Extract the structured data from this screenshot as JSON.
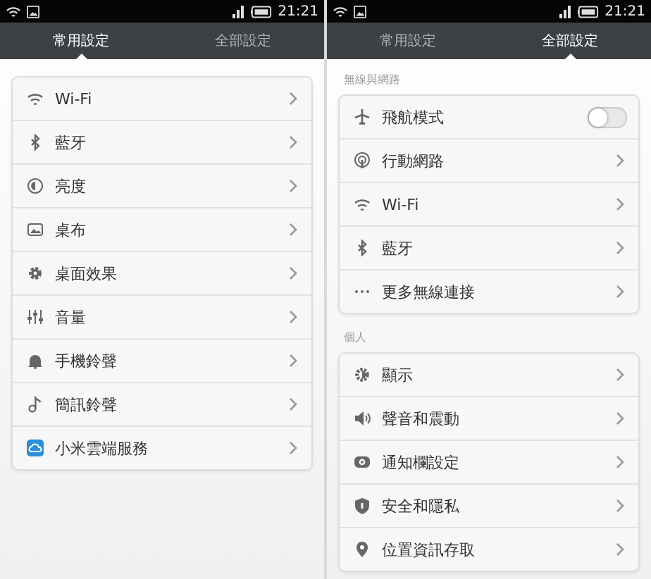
{
  "screens": [
    {
      "status_bar": {
        "time": "21:21"
      },
      "tabs": [
        {
          "label": "常用設定",
          "selected": true
        },
        {
          "label": "全部設定",
          "selected": false
        }
      ],
      "sections": [
        {
          "items": [
            {
              "label": "Wi-Fi",
              "kind": "link"
            },
            {
              "label": "藍牙",
              "kind": "link"
            },
            {
              "label": "亮度",
              "kind": "link"
            },
            {
              "label": "桌布",
              "kind": "link"
            },
            {
              "label": "桌面效果",
              "kind": "link"
            },
            {
              "label": "音量",
              "kind": "link"
            },
            {
              "label": "手機鈴聲",
              "kind": "link"
            },
            {
              "label": "簡訊鈴聲",
              "kind": "link"
            },
            {
              "label": "小米雲端服務",
              "kind": "link"
            }
          ]
        }
      ]
    },
    {
      "status_bar": {
        "time": "21:21"
      },
      "tabs": [
        {
          "label": "常用設定",
          "selected": false
        },
        {
          "label": "全部設定",
          "selected": true
        }
      ],
      "sections": [
        {
          "title": "無線與網路",
          "items": [
            {
              "label": "飛航模式",
              "kind": "toggle",
              "on": false
            },
            {
              "label": "行動網路",
              "kind": "link"
            },
            {
              "label": "Wi-Fi",
              "kind": "link"
            },
            {
              "label": "藍牙",
              "kind": "link"
            },
            {
              "label": "更多無線連接",
              "kind": "link"
            }
          ]
        },
        {
          "title": "個人",
          "items": [
            {
              "label": "顯示",
              "kind": "link"
            },
            {
              "label": "聲音和震動",
              "kind": "link"
            },
            {
              "label": "通知欄設定",
              "kind": "link"
            },
            {
              "label": "安全和隱私",
              "kind": "link"
            },
            {
              "label": "位置資訊存取",
              "kind": "link"
            }
          ]
        }
      ]
    }
  ]
}
